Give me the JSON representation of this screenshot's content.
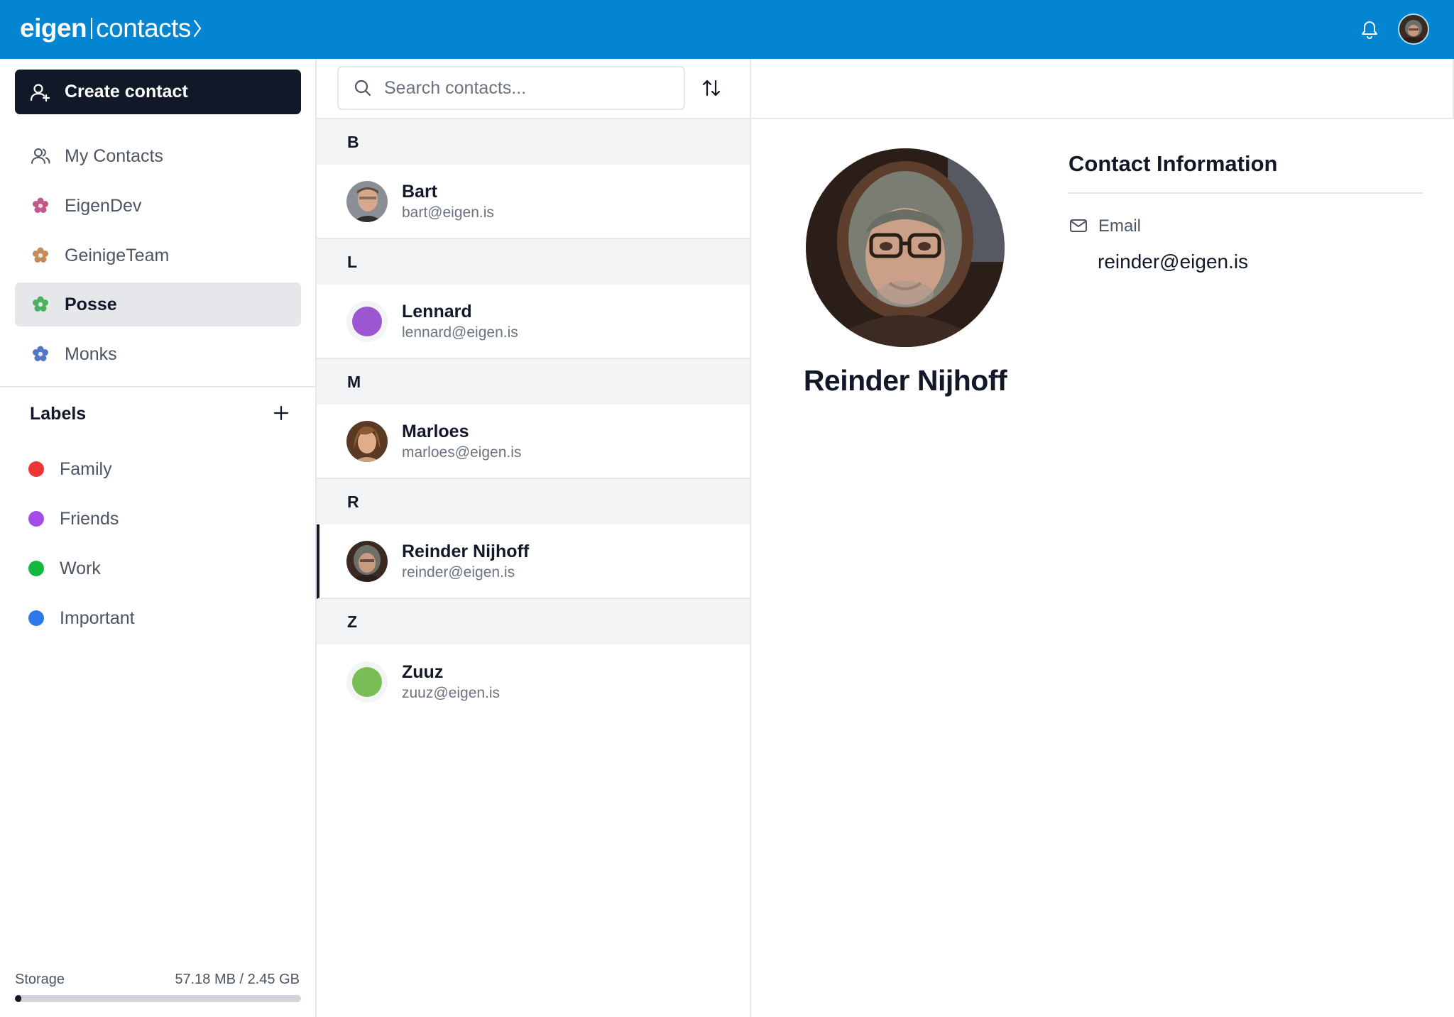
{
  "header": {
    "brand_primary": "eigen",
    "brand_secondary": "contacts",
    "bell_icon": "bell-icon",
    "accent_color": "#0385d1"
  },
  "sidebar": {
    "create_label": "Create contact",
    "groups": [
      {
        "label": "My Contacts",
        "icon": "users-icon",
        "active": false
      },
      {
        "label": "EigenDev",
        "icon": "flower-icon",
        "color": "#c2578a",
        "active": false
      },
      {
        "label": "GeinigeTeam",
        "icon": "flower-icon",
        "color": "#c58a5a",
        "active": false
      },
      {
        "label": "Posse",
        "icon": "flower-icon",
        "color": "#4caf62",
        "active": true
      },
      {
        "label": "Monks",
        "icon": "flower-icon",
        "color": "#5277c4",
        "active": false
      }
    ],
    "labels_title": "Labels",
    "labels": [
      {
        "label": "Family",
        "color": "#ef3434"
      },
      {
        "label": "Friends",
        "color": "#a54be8"
      },
      {
        "label": "Work",
        "color": "#13b83f"
      },
      {
        "label": "Important",
        "color": "#2f78ec"
      }
    ],
    "storage": {
      "label": "Storage",
      "value": "57.18 MB / 2.45 GB",
      "fraction": 0.023
    }
  },
  "list": {
    "search_placeholder": "Search contacts...",
    "sections": [
      {
        "letter": "B",
        "contacts": [
          {
            "name": "Bart",
            "email": "bart@eigen.is",
            "avatar": "photo",
            "selected": false
          }
        ]
      },
      {
        "letter": "L",
        "contacts": [
          {
            "name": "Lennard",
            "email": "lennard@eigen.is",
            "avatar": "color",
            "color": "#9c56cf",
            "selected": false
          }
        ]
      },
      {
        "letter": "M",
        "contacts": [
          {
            "name": "Marloes",
            "email": "marloes@eigen.is",
            "avatar": "photo",
            "selected": false
          }
        ]
      },
      {
        "letter": "R",
        "contacts": [
          {
            "name": "Reinder Nijhoff",
            "email": "reinder@eigen.is",
            "avatar": "photo",
            "selected": true
          }
        ]
      },
      {
        "letter": "Z",
        "contacts": [
          {
            "name": "Zuuz",
            "email": "zuuz@eigen.is",
            "avatar": "color",
            "color": "#79bd55",
            "selected": false
          }
        ]
      }
    ]
  },
  "detail": {
    "name": "Reinder Nijhoff",
    "section_title": "Contact Information",
    "email_label": "Email",
    "email_value": "reinder@eigen.is"
  }
}
